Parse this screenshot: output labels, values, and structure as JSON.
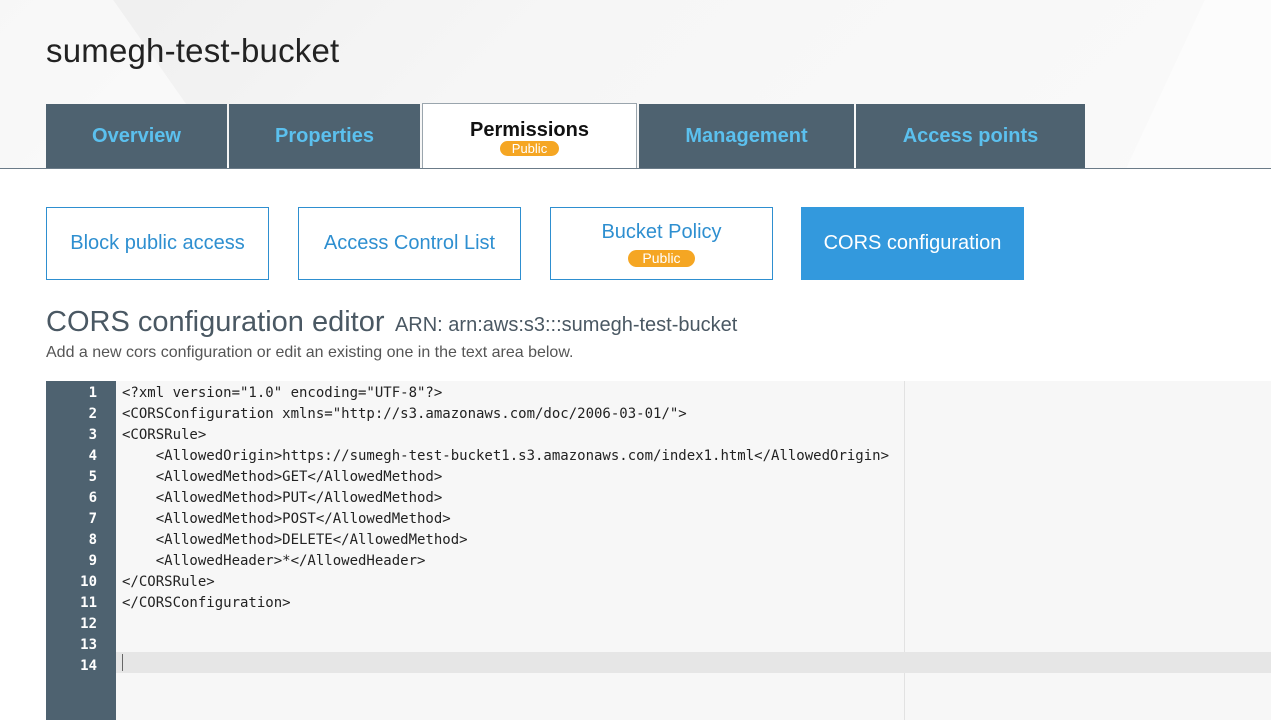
{
  "bucket": {
    "name": "sumegh-test-bucket"
  },
  "tabs": [
    {
      "label": "Overview"
    },
    {
      "label": "Properties"
    },
    {
      "label": "Permissions",
      "badge": "Public"
    },
    {
      "label": "Management"
    },
    {
      "label": "Access points"
    }
  ],
  "subtabs": [
    {
      "label": "Block public access"
    },
    {
      "label": "Access Control List"
    },
    {
      "label": "Bucket Policy",
      "badge": "Public"
    },
    {
      "label": "CORS configuration"
    }
  ],
  "editor": {
    "title": "CORS configuration editor",
    "arn": "ARN: arn:aws:s3:::sumegh-test-bucket",
    "description": "Add a new cors configuration or edit an existing one in the text area below.",
    "line_numbers": [
      "1",
      "2",
      "3",
      "4",
      "5",
      "6",
      "7",
      "8",
      "9",
      "10",
      "11",
      "12",
      "13",
      "14"
    ],
    "lines": [
      "<?xml version=\"1.0\" encoding=\"UTF-8\"?>",
      "<CORSConfiguration xmlns=\"http://s3.amazonaws.com/doc/2006-03-01/\">",
      "<CORSRule>",
      "    <AllowedOrigin>https://sumegh-test-bucket1.s3.amazonaws.com/index1.html</AllowedOrigin>",
      "    <AllowedMethod>GET</AllowedMethod>",
      "    <AllowedMethod>PUT</AllowedMethod>",
      "    <AllowedMethod>POST</AllowedMethod>",
      "    <AllowedMethod>DELETE</AllowedMethod>",
      "    <AllowedHeader>*</AllowedHeader>",
      "</CORSRule>",
      "</CORSConfiguration>",
      "",
      "",
      ""
    ]
  },
  "colors": {
    "tab_bg": "#4e6270",
    "tab_text": "#5bc0ee",
    "accent_blue": "#3399dd",
    "badge_orange": "#f5a623"
  }
}
